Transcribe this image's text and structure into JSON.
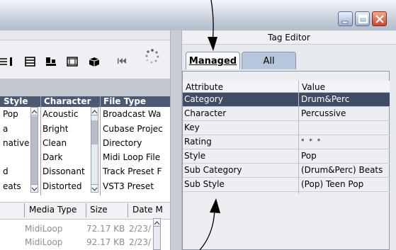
{
  "titlebar": {
    "buttons": [
      {
        "name": "minimize",
        "icon": "minimize-icon"
      },
      {
        "name": "maximize",
        "icon": "maximize-icon"
      },
      {
        "name": "close",
        "icon": "close-icon"
      }
    ]
  },
  "mediabay": {
    "toolbar_icons": [
      "list-view-icon",
      "grid-view-icon",
      "columns-icon",
      "filmstrip-icon",
      "cube-icon",
      "rewind-icon",
      "spinner-icon"
    ],
    "columns": [
      {
        "label": "Style",
        "values": [
          "Pop",
          "a",
          "native F",
          "",
          "d",
          "eats"
        ]
      },
      {
        "label": "Character",
        "values": [
          "Acoustic",
          "Bright",
          "Clean",
          "Dark",
          "Dissonant",
          "Distorted"
        ]
      },
      {
        "label": "File Type",
        "values": [
          "Broadcast Wa",
          "Cubase Projec",
          "Directory",
          "Midi Loop File",
          "Track Preset F",
          "VST3 Preset"
        ]
      }
    ],
    "results": {
      "headers": [
        "Media Type",
        "Size",
        "Date M"
      ],
      "rows": [
        {
          "type": "MidiLoop",
          "size": "72.17 KB",
          "date": "2/23/"
        },
        {
          "type": "MidiLoop",
          "size": "92.17 KB",
          "date": "2/23/"
        }
      ]
    }
  },
  "tag_editor": {
    "title": "Tag Editor",
    "tabs": [
      {
        "label": "Managed",
        "active": true
      },
      {
        "label": "All",
        "active": false
      }
    ],
    "headers": {
      "attribute": "Attribute",
      "value": "Value"
    },
    "rows": [
      {
        "attribute": "Category",
        "value": "Drum&Perc",
        "selected": true
      },
      {
        "attribute": "Character",
        "value": "Percussive"
      },
      {
        "attribute": "Key",
        "value": ""
      },
      {
        "attribute": "Rating",
        "value": "* * *"
      },
      {
        "attribute": "Style",
        "value": "Pop"
      },
      {
        "attribute": "Sub Category",
        "value": "(Drum&Perc) Beats"
      },
      {
        "attribute": "Sub Style",
        "value": "(Pop) Teen Pop"
      }
    ]
  },
  "colors": {
    "selection": "#3f4c63",
    "column_header": "#4b5a72",
    "tab_inactive": "#b7c6db"
  }
}
